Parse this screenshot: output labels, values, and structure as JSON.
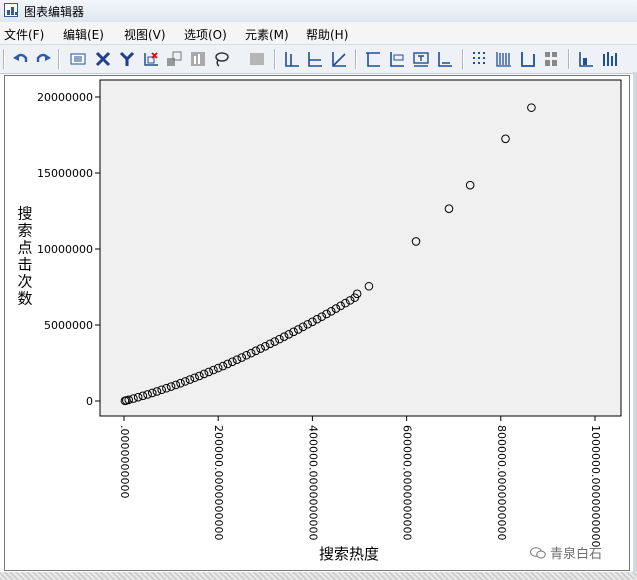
{
  "window": {
    "title": "图表编辑器"
  },
  "menu": [
    {
      "key": "file",
      "label": "文件(F)"
    },
    {
      "key": "edit",
      "label": "编辑(E)"
    },
    {
      "key": "view",
      "label": "视图(V)"
    },
    {
      "key": "options",
      "label": "选项(O)"
    },
    {
      "key": "elements",
      "label": "元素(M)"
    },
    {
      "key": "help",
      "label": "帮助(H)"
    }
  ],
  "toolbar": [
    {
      "icon": "undo-icon"
    },
    {
      "icon": "redo-icon"
    },
    {
      "icon": "properties-icon"
    },
    {
      "icon": "x-axis-icon"
    },
    {
      "icon": "y-axis-icon"
    },
    {
      "icon": "scale-icon"
    },
    {
      "icon": "rescale-icon"
    },
    {
      "icon": "chart-type-icon"
    },
    {
      "icon": "lasso-icon"
    },
    {
      "icon": "disabled-icon"
    },
    {
      "icon": "ref-line-y-icon"
    },
    {
      "icon": "ref-line-x-icon"
    },
    {
      "icon": "ref-line-eq-icon"
    },
    {
      "icon": "title-icon"
    },
    {
      "icon": "annotation-icon"
    },
    {
      "icon": "textbox-icon"
    },
    {
      "icon": "footnote-icon"
    },
    {
      "icon": "grid-icon"
    },
    {
      "icon": "gridlines-icon"
    },
    {
      "icon": "axis-icon"
    },
    {
      "icon": "legend-icon"
    },
    {
      "icon": "align-icon"
    },
    {
      "icon": "distribution-icon"
    }
  ],
  "colors": {
    "plot_bg": "#f0f0f0",
    "marker": "#000000",
    "accent": "#1f4e9a"
  },
  "chart_data": {
    "type": "scatter",
    "xlabel": "搜索热度",
    "ylabel": "搜索点击次数",
    "xlim": [
      0,
      1000000
    ],
    "ylim": [
      0,
      20000000
    ],
    "x_ticks": [
      0,
      200000,
      400000,
      600000,
      800000,
      1000000
    ],
    "x_tick_labels": [
      ".0000000000",
      "200000.0000000000",
      "400000.0000000000",
      "600000.0000000000",
      "800000.0000000000",
      "1000000.0000000000"
    ],
    "y_ticks": [
      0,
      5000000,
      10000000,
      15000000,
      20000000
    ],
    "y_tick_labels": [
      "0",
      "5000000",
      "10000000",
      "15000000",
      "20000000"
    ],
    "marker": "open-circle",
    "grid": false,
    "points": [
      [
        2000,
        10000
      ],
      [
        5000,
        40000
      ],
      [
        10000,
        80000
      ],
      [
        20000,
        160000
      ],
      [
        30000,
        250000
      ],
      [
        40000,
        340000
      ],
      [
        50000,
        430000
      ],
      [
        60000,
        530000
      ],
      [
        70000,
        630000
      ],
      [
        80000,
        740000
      ],
      [
        90000,
        840000
      ],
      [
        100000,
        950000
      ],
      [
        110000,
        1060000
      ],
      [
        120000,
        1170000
      ],
      [
        130000,
        1290000
      ],
      [
        140000,
        1410000
      ],
      [
        150000,
        1530000
      ],
      [
        160000,
        1650000
      ],
      [
        170000,
        1780000
      ],
      [
        180000,
        1910000
      ],
      [
        190000,
        2040000
      ],
      [
        200000,
        2170000
      ],
      [
        210000,
        2300000
      ],
      [
        220000,
        2440000
      ],
      [
        230000,
        2580000
      ],
      [
        240000,
        2720000
      ],
      [
        250000,
        2860000
      ],
      [
        260000,
        3010000
      ],
      [
        270000,
        3150000
      ],
      [
        280000,
        3300000
      ],
      [
        290000,
        3450000
      ],
      [
        300000,
        3600000
      ],
      [
        310000,
        3760000
      ],
      [
        320000,
        3910000
      ],
      [
        330000,
        4070000
      ],
      [
        340000,
        4230000
      ],
      [
        350000,
        4390000
      ],
      [
        360000,
        4550000
      ],
      [
        370000,
        4710000
      ],
      [
        380000,
        4880000
      ],
      [
        390000,
        5050000
      ],
      [
        400000,
        5210000
      ],
      [
        410000,
        5380000
      ],
      [
        420000,
        5550000
      ],
      [
        430000,
        5730000
      ],
      [
        440000,
        5900000
      ],
      [
        450000,
        6080000
      ],
      [
        460000,
        6260000
      ],
      [
        470000,
        6440000
      ],
      [
        480000,
        6620000
      ],
      [
        490000,
        6800000
      ],
      [
        495000,
        7050000
      ],
      [
        520000,
        7550000
      ],
      [
        620000,
        10500000
      ],
      [
        690000,
        12650000
      ],
      [
        735000,
        14200000
      ],
      [
        810000,
        17250000
      ],
      [
        865000,
        19300000
      ]
    ]
  },
  "watermark": {
    "text": "青泉白石"
  }
}
